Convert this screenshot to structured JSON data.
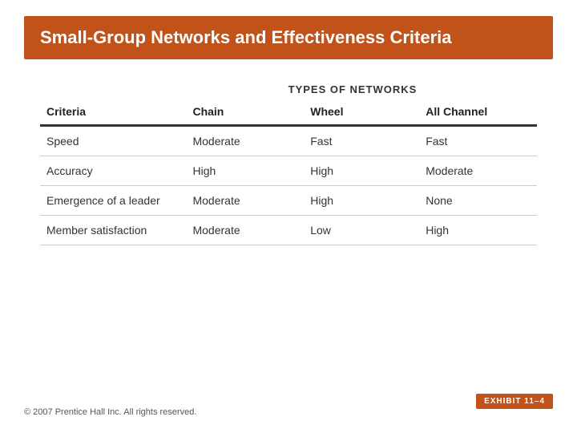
{
  "title": "Small-Group Networks and Effectiveness Criteria",
  "types_header": "TYPES OF NETWORKS",
  "columns": {
    "criteria": "Criteria",
    "chain": "Chain",
    "wheel": "Wheel",
    "all_channel": "All Channel"
  },
  "rows": [
    {
      "criteria": "Speed",
      "chain": "Moderate",
      "wheel": "Fast",
      "all_channel": "Fast"
    },
    {
      "criteria": "Accuracy",
      "chain": "High",
      "wheel": "High",
      "all_channel": "Moderate"
    },
    {
      "criteria": "Emergence of a leader",
      "chain": "Moderate",
      "wheel": "High",
      "all_channel": "None"
    },
    {
      "criteria": "Member satisfaction",
      "chain": "Moderate",
      "wheel": "Low",
      "all_channel": "High"
    }
  ],
  "exhibit": "EXHIBIT 11–4",
  "footer": "© 2007 Prentice Hall Inc. All rights reserved."
}
